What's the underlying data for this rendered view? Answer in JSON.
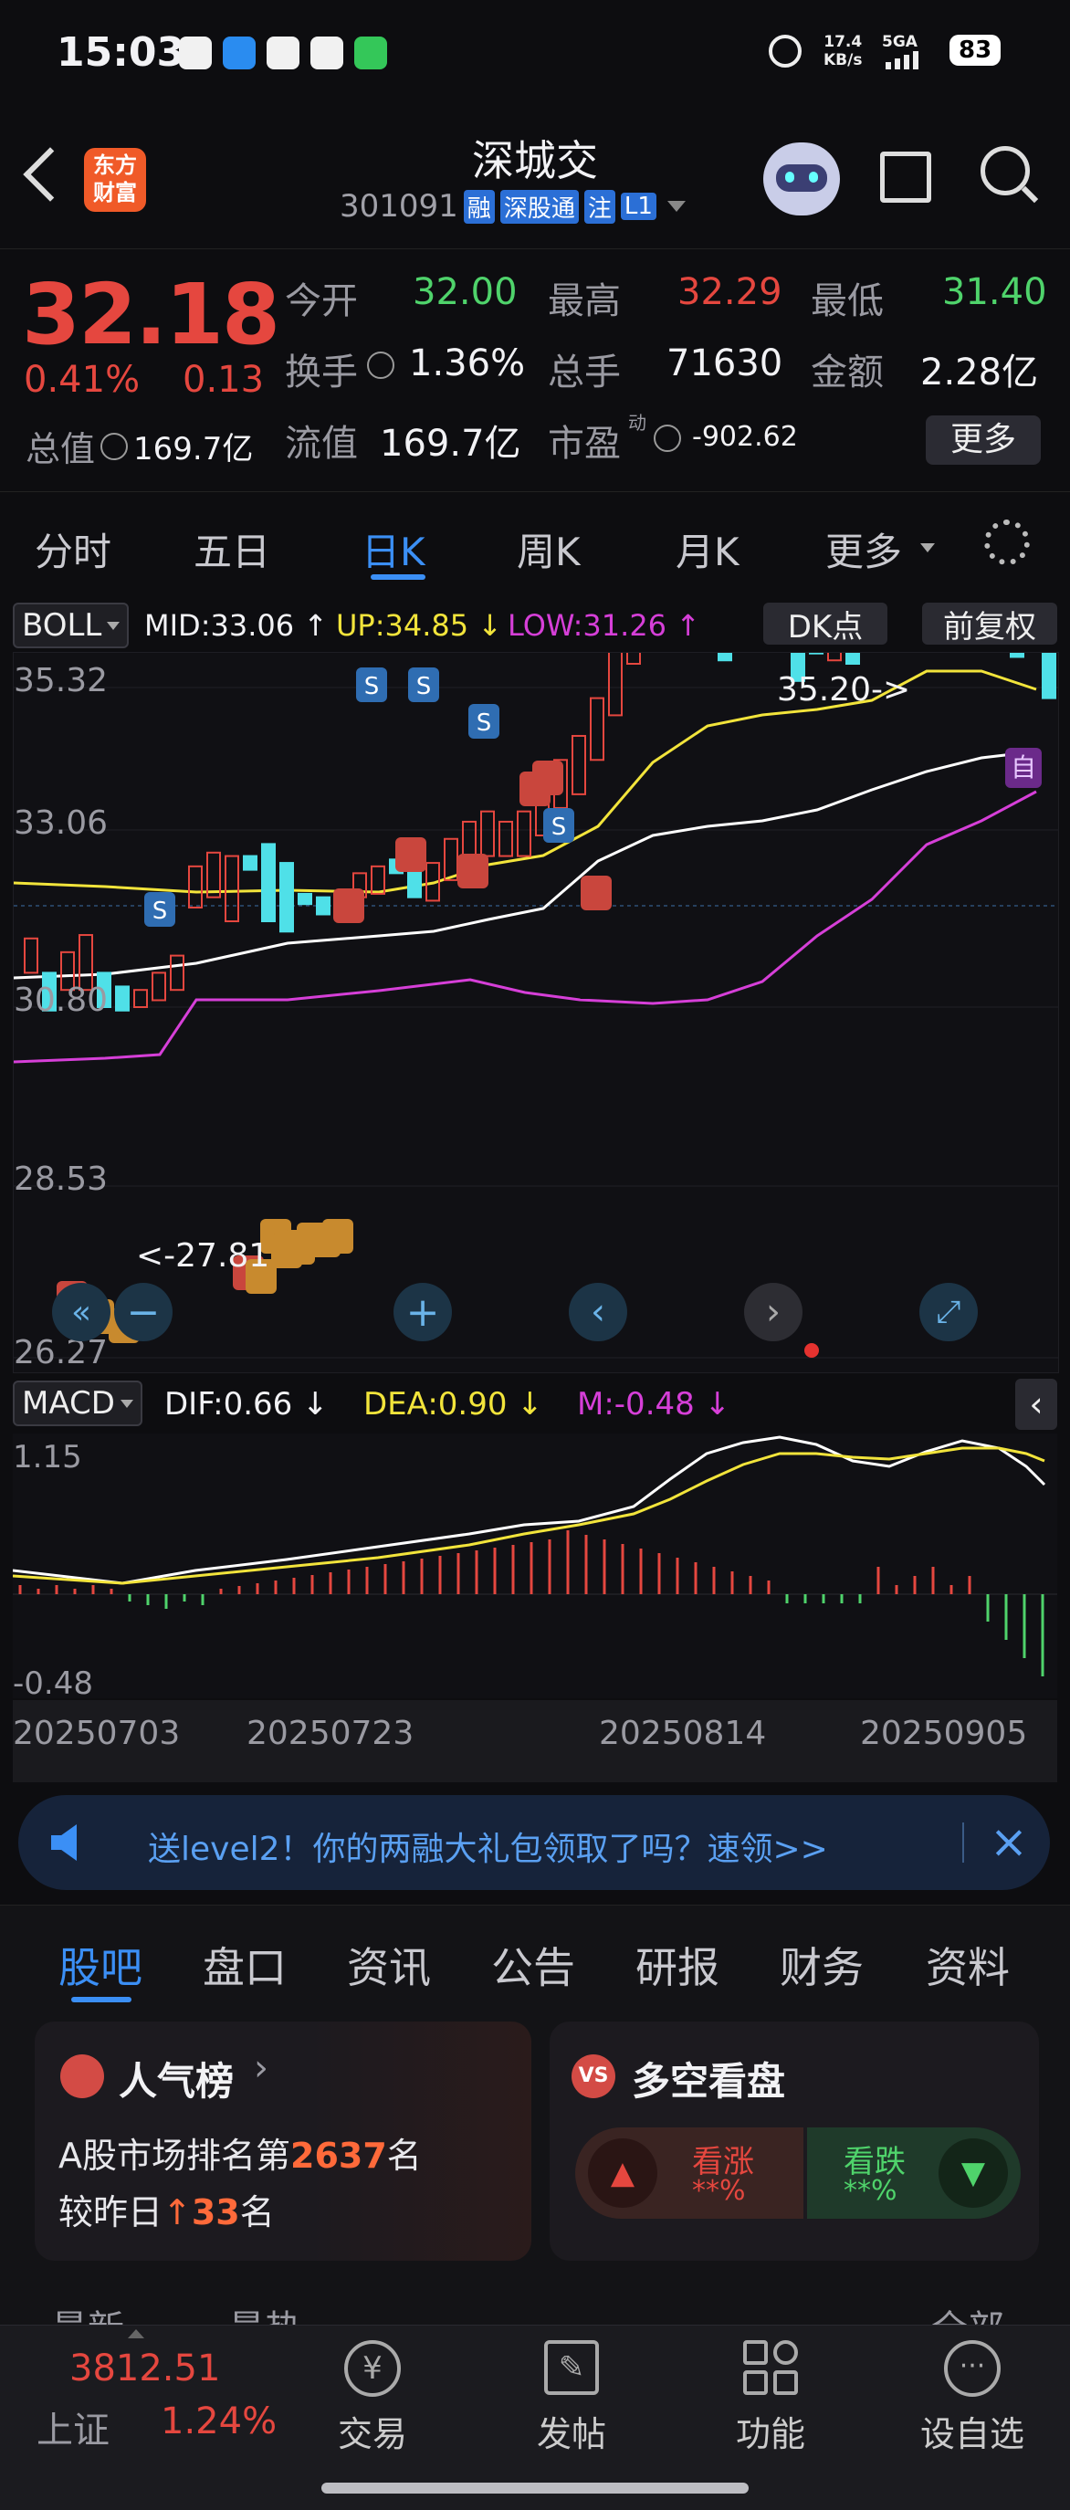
{
  "status_bar": {
    "time": "15:03",
    "net_speed_top": "17.4",
    "net_speed_unit": "KB/s",
    "signal": "5GA",
    "battery": "83"
  },
  "header": {
    "logo_line1": "东方",
    "logo_line2": "财富",
    "title": "深城交",
    "code": "301091",
    "tags": [
      "融",
      "深股通",
      "注",
      "L1"
    ]
  },
  "quote": {
    "price": "32.18",
    "change_pct": "0.41%",
    "change": "0.13",
    "total_value_label": "总值",
    "total_value": "169.7亿",
    "open_label": "今开",
    "open": "32.00",
    "high_label": "最高",
    "high": "32.29",
    "low_label": "最低",
    "low": "31.40",
    "turnover_label": "换手",
    "turnover": "1.36%",
    "volume_label": "总手",
    "volume": "71630",
    "amount_label": "金额",
    "amount": "2.28亿",
    "float_label": "流值",
    "float_value": "169.7亿",
    "pe_label": "市盈",
    "pe_sup": "动",
    "pe": "-902.62",
    "more": "更多"
  },
  "period_tabs": [
    "分时",
    "五日",
    "日K",
    "周K",
    "月K",
    "更多"
  ],
  "active_tab": "日K",
  "indicator_bar": {
    "name": "BOLL",
    "mid": "MID:33.06 ↑",
    "up": "UP:34.85 ↓",
    "low": "LOW:31.26 ↑",
    "dk": "DK点",
    "adjust": "前复权"
  },
  "kline": {
    "y_labels": [
      "35.32",
      "33.06",
      "30.80",
      "28.53",
      "26.27"
    ],
    "high_label": "35.20->",
    "low_label": "<-27.81",
    "self_tag": "自"
  },
  "macd_bar": {
    "name": "MACD",
    "dif": "DIF:0.66 ↓",
    "dea": "DEA:0.90 ↓",
    "m": "M:-0.48 ↓"
  },
  "macd": {
    "y_top": "1.15",
    "y_bottom": "-0.48"
  },
  "dates": [
    "20250703",
    "20250723",
    "20250814",
    "20250905"
  ],
  "banner": {
    "text": "送level2！你的两融大礼包领取了吗？速领>>"
  },
  "section_tabs": [
    "股吧",
    "盘口",
    "资讯",
    "公告",
    "研报",
    "财务",
    "资料"
  ],
  "active_section": "股吧",
  "popularity": {
    "title": "人气榜",
    "line1_prefix": "A股市场排名第",
    "rank": "2637",
    "line1_suffix": "名",
    "line2_prefix": "较昨日",
    "delta": "33",
    "line2_suffix": "名"
  },
  "longshort": {
    "title": "多空看盘",
    "up_label": "看涨",
    "up_value": "**%",
    "down_label": "看跌",
    "down_value": "**%"
  },
  "partial_row": {
    "left1": "最新",
    "left2": "最热",
    "right": "全部"
  },
  "bottom_nav": {
    "index_value": "3812.51",
    "index_name": "上证",
    "index_pct": "1.24%",
    "items": [
      "交易",
      "发帖",
      "功能",
      "设自选"
    ]
  },
  "colors": {
    "up": "#e5473f",
    "down": "#4fd36b",
    "accent": "#3b8ff5",
    "cyan": "#4fe0e8",
    "yellow": "#f2e43b",
    "magenta": "#d63fd8"
  }
}
